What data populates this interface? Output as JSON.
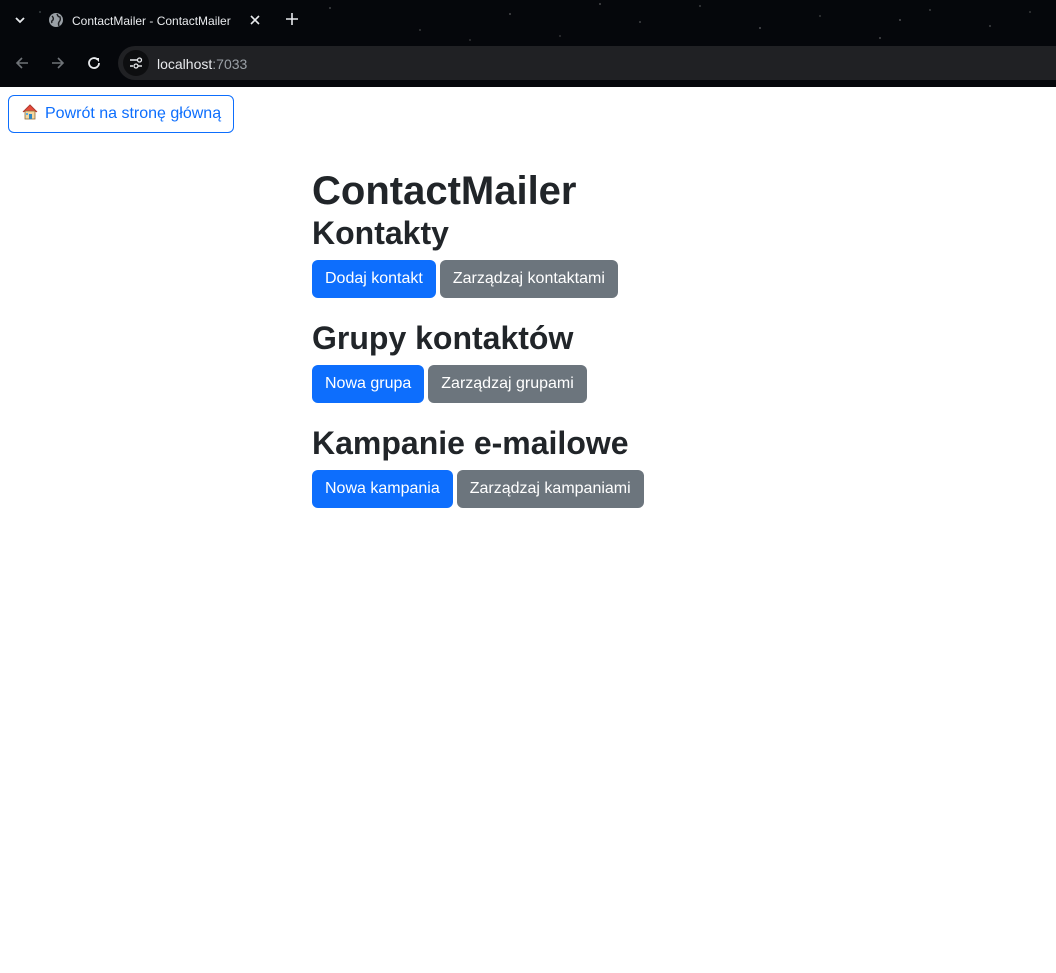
{
  "browser": {
    "tab_title": "ContactMailer - ContactMailer",
    "url_host": "localhost",
    "url_port": ":7033"
  },
  "page": {
    "home_button_label": "Powrót na stronę główną",
    "app_title": "ContactMailer",
    "sections": [
      {
        "title": "Kontakty",
        "primary_label": "Dodaj kontakt",
        "secondary_label": "Zarządzaj kontaktami"
      },
      {
        "title": "Grupy kontaktów",
        "primary_label": "Nowa grupa",
        "secondary_label": "Zarządzaj grupami"
      },
      {
        "title": "Kampanie e-mailowe",
        "primary_label": "Nowa kampania",
        "secondary_label": "Zarządzaj kampaniami"
      }
    ]
  },
  "colors": {
    "primary": "#0d6efd",
    "secondary": "#6c757d",
    "text": "#212529"
  }
}
